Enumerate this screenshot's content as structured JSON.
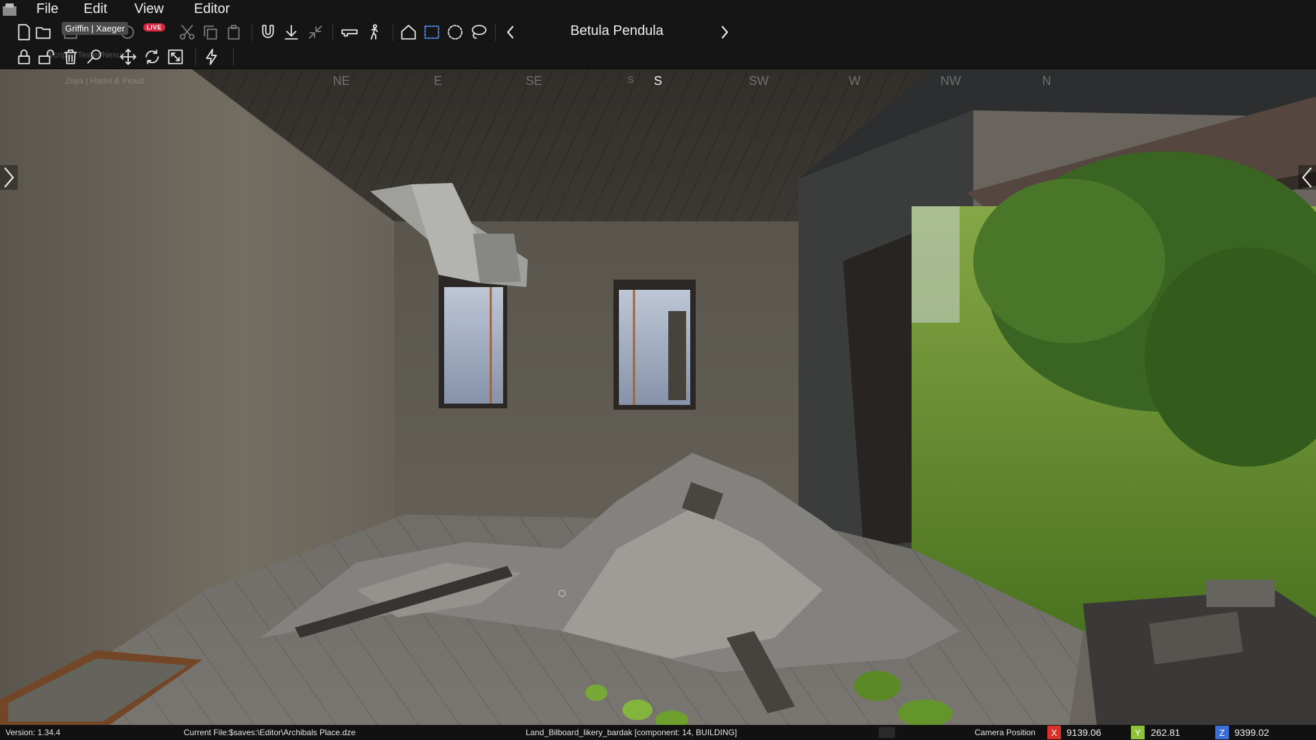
{
  "menu": {
    "file": "File",
    "edit": "Edit",
    "view": "View",
    "editor": "Editor"
  },
  "toolbar": {
    "object_title": "Betula Pendula",
    "user_tooltip": "Griffin | Xaeger",
    "live_badge": "LIVE"
  },
  "overlay": {
    "ghost_tooltip_a": "Scripts: Tester/Nexus",
    "ghost_tooltip_b": "Zoya | Harlot & Proud"
  },
  "compass": {
    "ne": "NE",
    "e": "E",
    "se": "SE",
    "s_small": "S",
    "s": "S",
    "sw": "SW",
    "w": "W",
    "nw": "NW",
    "n": "N"
  },
  "status": {
    "version": "Version: 1.34.4",
    "current_file": "Current File:$saves:\\Editor\\Archibals Place.dze",
    "selected_object": "Land_Bilboard_likery_bardak [component: 14, BUILDING]",
    "camera_label": "Camera Position",
    "x_label": "X",
    "x_value": "9139.06",
    "y_label": "Y",
    "y_value": "262.81",
    "z_label": "Z",
    "z_value": "9399.02"
  },
  "colors": {
    "x_axis": "#d9302a",
    "y_axis": "#8fc23a",
    "z_axis": "#3b6fd8",
    "selection_accent": "#4d8ff0",
    "live": "#d7263d"
  }
}
